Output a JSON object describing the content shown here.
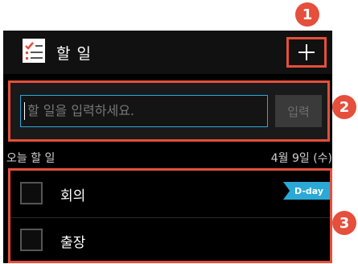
{
  "header": {
    "title": "할 일",
    "app_icon": "checklist-icon",
    "add_icon": "plus-icon"
  },
  "callouts": [
    "1",
    "2",
    "3"
  ],
  "input": {
    "placeholder": "할 일을 입력하세요.",
    "submit_label": "입력"
  },
  "section": {
    "title": "오늘 할 일",
    "date": "4월 9일 (수)"
  },
  "tasks": [
    {
      "label": "회의",
      "badge": "D-day"
    },
    {
      "label": "출장"
    }
  ],
  "colors": {
    "accent": "#e54f3b",
    "highlight": "#2aa9d6",
    "background": "#000000"
  }
}
